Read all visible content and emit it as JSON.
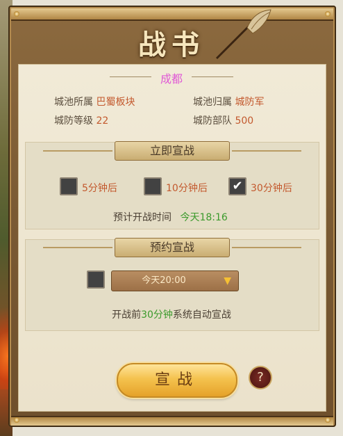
{
  "window": {
    "title": "战书"
  },
  "city": {
    "name": "成都"
  },
  "info": {
    "ownership_label": "城池所属",
    "ownership_value": "巴蜀板块",
    "belong_label": "城池归属",
    "belong_value": "城防军",
    "defense_level_label": "城防等级",
    "defense_level_value": "22",
    "defense_troops_label": "城防部队",
    "defense_troops_value": "500"
  },
  "immediate": {
    "title": "立即宣战",
    "options": [
      {
        "label": "5分钟后",
        "checked": false
      },
      {
        "label": "10分钟后",
        "checked": false
      },
      {
        "label": "30分钟后",
        "checked": true
      }
    ],
    "estimate_label": "预计开战时间",
    "estimate_time": "今天18:16"
  },
  "scheduled": {
    "title": "预约宣战",
    "checkbox_checked": false,
    "select_value": "今天20:00",
    "auto_prefix": "开战前",
    "auto_highlight": "30分钟",
    "auto_suffix": "系统自动宣战"
  },
  "actions": {
    "declare_label": "宣战",
    "help_label": "?"
  },
  "icons": {
    "checkmark": "✔",
    "dropdown": "▼"
  },
  "colors": {
    "city": "#e05ad6",
    "value_red": "#c3592e",
    "time_green": "#3b9a2c",
    "button_gold": "#f4c24e"
  }
}
